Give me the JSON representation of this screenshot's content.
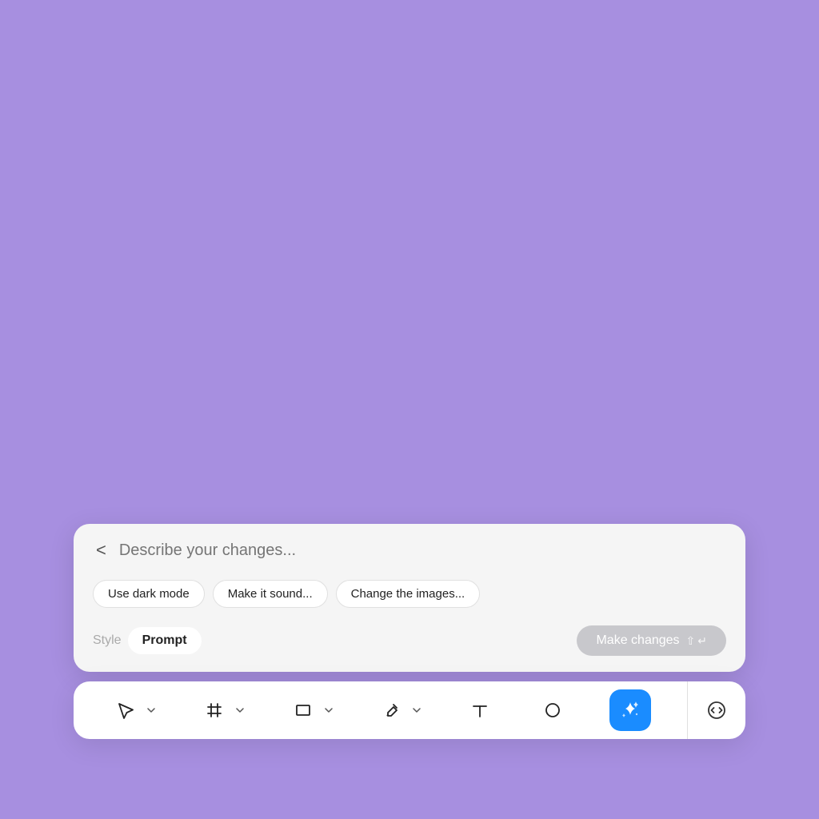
{
  "background_color": "#a78fe0",
  "prompt_panel": {
    "input_placeholder": "Describe your changes...",
    "back_button_label": "<",
    "suggestions": [
      {
        "label": "Use dark mode"
      },
      {
        "label": "Make it sound..."
      },
      {
        "label": "Change the images..."
      }
    ],
    "style_label": "Style",
    "tab_prompt_label": "Prompt",
    "make_changes_label": "Make changes"
  },
  "toolbar": {
    "tools": [
      {
        "name": "select",
        "label": "Select"
      },
      {
        "name": "frame",
        "label": "Frame"
      },
      {
        "name": "rectangle",
        "label": "Rectangle"
      },
      {
        "name": "pen",
        "label": "Pen"
      },
      {
        "name": "text",
        "label": "Text"
      },
      {
        "name": "ellipse",
        "label": "Ellipse"
      },
      {
        "name": "ai",
        "label": "AI"
      }
    ],
    "code_button_label": "</>"
  }
}
